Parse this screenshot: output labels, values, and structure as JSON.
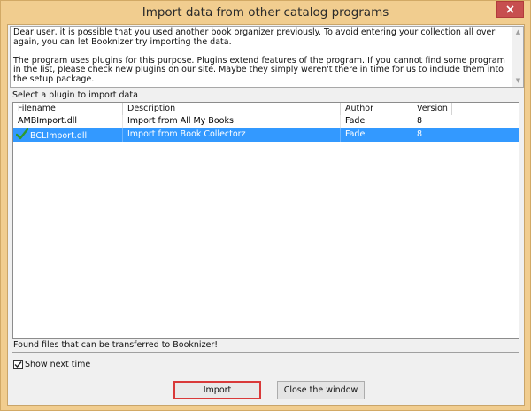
{
  "window": {
    "title": "Import data from other catalog programs"
  },
  "intro": {
    "paragraph1": "Dear user, it is possible that you used another book organizer previously. To avoid entering your collection all over again, you can let Booknizer try importing the data.",
    "paragraph2": "The program uses plugins for this purpose. Plugins extend features of the program. If you cannot find some program in the list, please check new plugins on our site. Maybe they simply weren't there in time for us to include them into the setup package."
  },
  "plugins": {
    "group_label": "Select a plugin to import data",
    "columns": [
      "Filename",
      "Description",
      "Author",
      "Version"
    ],
    "rows": [
      {
        "filename": "AMBImport.dll",
        "description": "Import from All My Books",
        "author": "Fade",
        "version": "8",
        "selected": false
      },
      {
        "filename": "BCLImport.dll",
        "description": "Import from Book Collectorz",
        "author": "Fade",
        "version": "8",
        "selected": true
      }
    ],
    "status_text": "Found files that can be transferred to Booknizer!"
  },
  "options": {
    "show_next_time_label": "Show next time",
    "show_next_time_checked": true
  },
  "buttons": {
    "import_label": "Import",
    "close_label": "Close the window"
  },
  "colors": {
    "title_bar": "#f1cd8f",
    "selection": "#3399ff",
    "close_button": "#c74f4f",
    "import_focus_border": "#d93939"
  }
}
